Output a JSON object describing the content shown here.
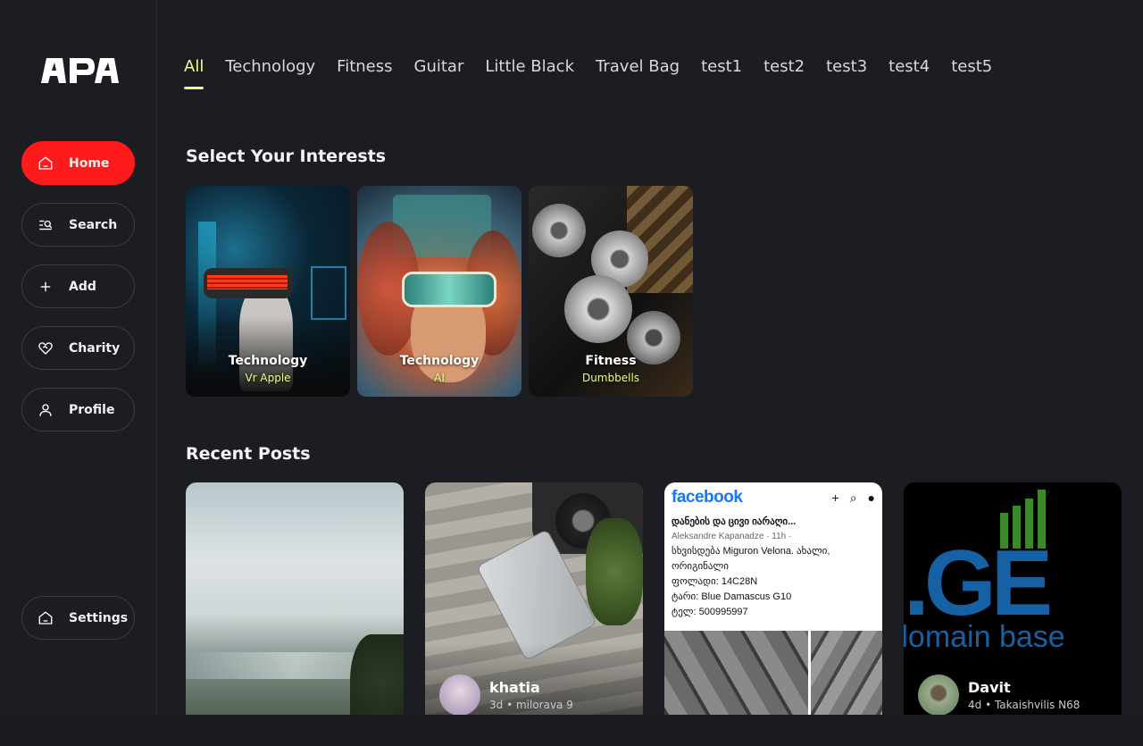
{
  "sidebar": {
    "logo_alt": "APA",
    "nav": [
      {
        "label": "Home",
        "icon": "home-icon"
      },
      {
        "label": "Search",
        "icon": "search-icon"
      },
      {
        "label": "Add",
        "icon": "plus-icon"
      },
      {
        "label": "Charity",
        "icon": "heart-handshake-icon"
      },
      {
        "label": "Profile",
        "icon": "user-icon"
      }
    ],
    "settings": {
      "label": "Settings",
      "icon": "home-icon"
    }
  },
  "tabs": [
    "All",
    "Technology",
    "Fitness",
    "Guitar",
    "Little Black",
    "Travel Bag",
    "test1",
    "test2",
    "test3",
    "test4",
    "test5"
  ],
  "active_tab": "All",
  "interests": {
    "title": "Select Your Interests",
    "items": [
      {
        "category": "Technology",
        "sub": "Vr Apple"
      },
      {
        "category": "Technology",
        "sub": "AI"
      },
      {
        "category": "Fitness",
        "sub": "Dumbbells"
      }
    ]
  },
  "recent": {
    "title": "Recent Posts",
    "posts": [
      {
        "name": "",
        "meta": ""
      },
      {
        "name": "khatia",
        "meta": "3d • milorava 9"
      },
      {
        "name": "",
        "meta": ""
      },
      {
        "name": "Davit",
        "meta": "4d • Takaishvilis N68"
      }
    ]
  },
  "fb_mock": {
    "logo": "facebook",
    "title": "დანების და ცივი იარაღი...",
    "author": "Aleksandre Kapanadze · 11h ·",
    "line1": "სხვისდება Miguron Velona. ახალი, ორიგინალი",
    "line2": "ფოლადი: 14C28N",
    "line3": "ტარი: Blue Damascus G10",
    "line4": "ტელ: 500995997"
  },
  "ge_mock": {
    "big": ".GE",
    "sub": "domain base"
  },
  "colors": {
    "accent_red": "#ff1b1b",
    "accent_lime": "#e9ff8a",
    "bg": "#1c1d22"
  }
}
